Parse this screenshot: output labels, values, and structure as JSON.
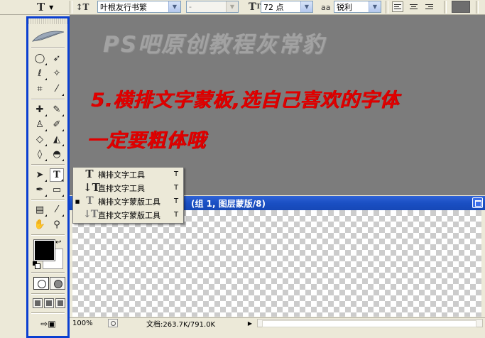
{
  "options_bar": {
    "tool_preset_icon": "horizontal-type-tool-icon",
    "orientation_icon": "text-orientation-icon",
    "font_family": "叶根友行书繁",
    "font_style": "-",
    "size_icon": "font-size-icon",
    "font_size": "72 点",
    "aa_icon_label": "aa",
    "antialias": "锐利",
    "align_buttons": [
      "align-left-icon",
      "align-center-icon",
      "align-right-icon"
    ],
    "text_color": "#6e6e6e"
  },
  "workspace": {
    "watermark": "PS吧原创教程灰常豹",
    "instruction_line1": "5.横排文字蒙板,选自己喜欢的字体",
    "instruction_line2": "一定要粗体哦",
    "bg_color": "#7c7c7c",
    "text_color": "#e00000"
  },
  "document": {
    "title": "(组 1, 图层蒙版/8)",
    "zoom": "100%",
    "doc_info": "文档:263.7K/791.0K"
  },
  "flyout": {
    "items": [
      {
        "label": "横排文字工具",
        "shortcut": "T",
        "icon": "horizontal-type-icon",
        "selected": false
      },
      {
        "label": "直排文字工具",
        "shortcut": "T",
        "icon": "vertical-type-icon",
        "selected": false
      },
      {
        "label": "横排文字蒙版工具",
        "shortcut": "T",
        "icon": "horizontal-type-mask-icon",
        "selected": true
      },
      {
        "label": "直排文字蒙版工具",
        "shortcut": "T",
        "icon": "vertical-type-mask-icon",
        "selected": false
      }
    ],
    "bullet": "■"
  },
  "toolbox": {
    "accent_color": "#0a3fd1",
    "foreground_color": "#000000",
    "background_color": "#ffffff"
  }
}
